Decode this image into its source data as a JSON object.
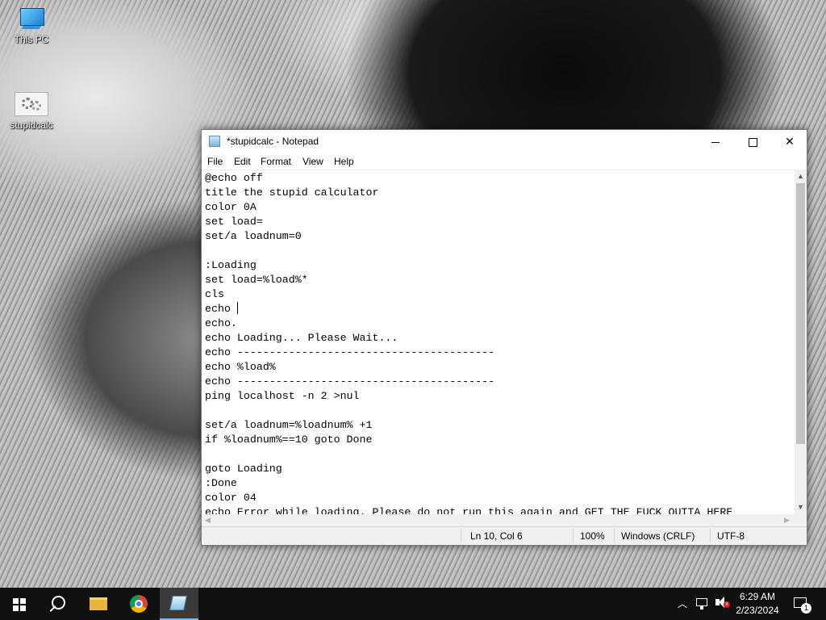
{
  "desktop": {
    "icons": [
      {
        "label": "This PC",
        "icon": "computer-icon"
      },
      {
        "label": "stupidcalc",
        "icon": "batch-file-gear-icon"
      }
    ]
  },
  "notepad": {
    "title": "*stupidcalc - Notepad",
    "menu": [
      "File",
      "Edit",
      "Format",
      "View",
      "Help"
    ],
    "lines": [
      "@echo off",
      "title the stupid calculator",
      "color 0A",
      "set load=",
      "set/a loadnum=0",
      "",
      ":Loading",
      "set load=%load%*",
      "cls",
      "echo ",
      "echo.",
      "echo Loading... Please Wait...",
      "echo ----------------------------------------",
      "echo %load%",
      "echo ----------------------------------------",
      "ping localhost -n 2 >nul",
      "",
      "set/a loadnum=%loadnum% +1",
      "if %loadnum%==10 goto Done",
      "",
      "goto Loading",
      ":Done",
      "color 04",
      "echo Error while loading. Please do not run this again and GET THE FUCK OUTTA HERE"
    ],
    "status": {
      "position": "Ln 10, Col 6",
      "zoom": "100%",
      "line_ending": "Windows (CRLF)",
      "encoding": "UTF-8"
    }
  },
  "taskbar": {
    "time": "6:29 AM",
    "date": "2/23/2024",
    "notification_count": "1",
    "pinned": [
      "start-icon",
      "search-icon",
      "file-explorer-icon",
      "chrome-icon",
      "notepad-icon"
    ]
  }
}
